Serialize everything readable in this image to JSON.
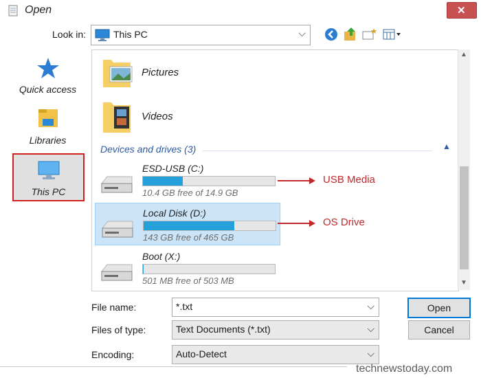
{
  "window": {
    "title": "Open",
    "close_glyph": "✕"
  },
  "lookin": {
    "label": "Look in:",
    "value": "This PC"
  },
  "toolbar": {
    "icons": [
      "back-icon",
      "up-folder-icon",
      "new-folder-icon",
      "view-menu-icon"
    ]
  },
  "sidebar": {
    "items": [
      {
        "label": "Quick access",
        "icon": "star-icon"
      },
      {
        "label": "Libraries",
        "icon": "libraries-icon"
      },
      {
        "label": "This PC",
        "icon": "this-pc-icon",
        "selected": true
      }
    ]
  },
  "files": {
    "folders": [
      {
        "label": "Pictures"
      },
      {
        "label": "Videos"
      }
    ],
    "group_header": "Devices and drives (3)",
    "drives": [
      {
        "name": "ESD-USB (C:)",
        "free_text": "10.4 GB free of 14.9 GB",
        "used_fraction": 0.3,
        "selected": false
      },
      {
        "name": "Local Disk (D:)",
        "free_text": "143 GB free of 465 GB",
        "used_fraction": 0.69,
        "selected": true
      },
      {
        "name": "Boot (X:)",
        "free_text": "501 MB free of 503 MB",
        "used_fraction": 0.004,
        "selected": false
      }
    ]
  },
  "annotations": {
    "usb": "USB Media",
    "os": "OS Drive"
  },
  "form": {
    "filename_label": "File name:",
    "filename_value": "*.txt",
    "filetype_label": "Files of type:",
    "filetype_value": "Text Documents (*.txt)",
    "encoding_label": "Encoding:",
    "encoding_value": "Auto-Detect"
  },
  "buttons": {
    "open": "Open",
    "cancel": "Cancel"
  },
  "watermark": "technewstoday.com",
  "colors": {
    "accent": "#0078d7",
    "bar_fill": "#26a0da",
    "annotation": "#c0282a",
    "close": "#c75050"
  }
}
